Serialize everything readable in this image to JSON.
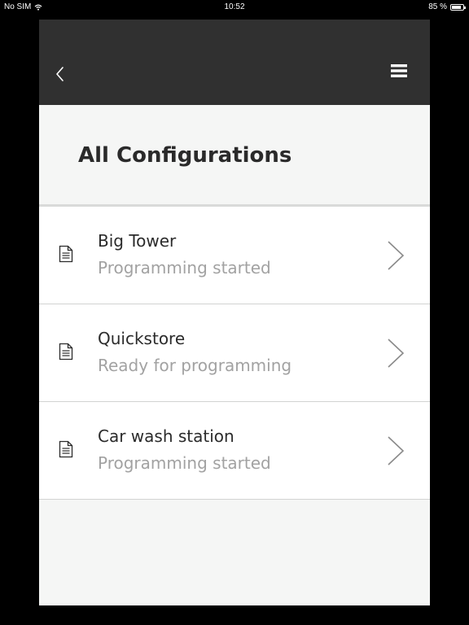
{
  "status_bar": {
    "carrier": "No SIM",
    "time": "10:52",
    "battery": "85 %",
    "battery_level": 0.85,
    "wifi_icon": "wifi-icon",
    "battery_icon": "battery-icon"
  },
  "navbar": {
    "back_icon": "chevron-left-icon",
    "menu_icon": "hamburger-menu-icon",
    "background": "#303030"
  },
  "page": {
    "title": "All Configurations"
  },
  "configurations": [
    {
      "name": "Big Tower",
      "status": "Programming started"
    },
    {
      "name": "Quickstore",
      "status": "Ready for programming"
    },
    {
      "name": "Car wash station",
      "status": "Programming started"
    }
  ],
  "colors": {
    "navbar_bg": "#303030",
    "page_bg": "#f5f6f5",
    "row_bg": "#ffffff",
    "primary_text": "#2b2b2b",
    "secondary_text": "#a2a2a2",
    "divider": "#d2d3d2"
  }
}
